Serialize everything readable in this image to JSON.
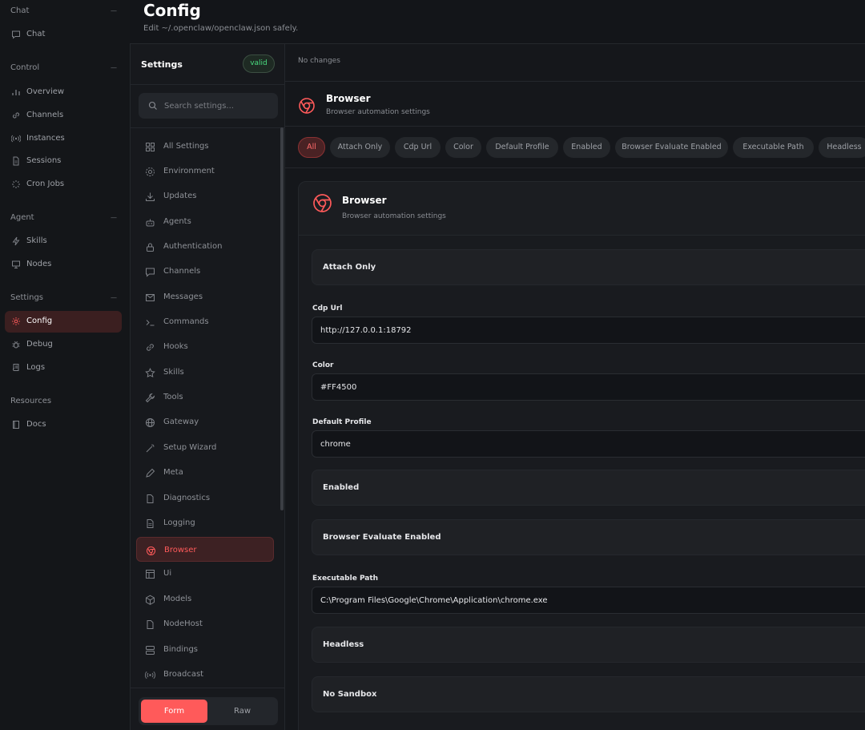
{
  "nav": {
    "groups": [
      {
        "title": "Chat",
        "items": [
          {
            "label": "Chat",
            "icon": "chat-bubble-icon"
          }
        ]
      },
      {
        "title": "Control",
        "items": [
          {
            "label": "Overview",
            "icon": "bar-chart-icon"
          },
          {
            "label": "Channels",
            "icon": "link-icon"
          },
          {
            "label": "Instances",
            "icon": "radio-icon"
          },
          {
            "label": "Sessions",
            "icon": "document-icon"
          },
          {
            "label": "Cron Jobs",
            "icon": "loader-icon"
          }
        ]
      },
      {
        "title": "Agent",
        "items": [
          {
            "label": "Skills",
            "icon": "lightning-icon"
          },
          {
            "label": "Nodes",
            "icon": "monitor-icon"
          }
        ]
      },
      {
        "title": "Settings",
        "items": [
          {
            "label": "Config",
            "icon": "gear-icon"
          },
          {
            "label": "Debug",
            "icon": "bug-icon"
          },
          {
            "label": "Logs",
            "icon": "scroll-icon"
          }
        ]
      },
      {
        "title": "Resources",
        "items": [
          {
            "label": "Docs",
            "icon": "book-icon"
          }
        ]
      }
    ],
    "active": "Config"
  },
  "header": {
    "title": "Config",
    "subtitle": "Edit ~/.openclaw/openclaw.json safely."
  },
  "settings_panel": {
    "title": "Settings",
    "status_badge": "valid",
    "search_placeholder": "Search settings...",
    "sections": [
      {
        "label": "All Settings",
        "icon": "grid-icon"
      },
      {
        "label": "Environment",
        "icon": "gear-icon"
      },
      {
        "label": "Updates",
        "icon": "download-icon"
      },
      {
        "label": "Agents",
        "icon": "robot-icon"
      },
      {
        "label": "Authentication",
        "icon": "lock-icon"
      },
      {
        "label": "Channels",
        "icon": "chat-bubble-icon"
      },
      {
        "label": "Messages",
        "icon": "mail-icon"
      },
      {
        "label": "Commands",
        "icon": "terminal-icon"
      },
      {
        "label": "Hooks",
        "icon": "link-icon"
      },
      {
        "label": "Skills",
        "icon": "star-icon"
      },
      {
        "label": "Tools",
        "icon": "wrench-icon"
      },
      {
        "label": "Gateway",
        "icon": "globe-icon"
      },
      {
        "label": "Setup Wizard",
        "icon": "wand-icon"
      },
      {
        "label": "Meta",
        "icon": "pencil-icon"
      },
      {
        "label": "Diagnostics",
        "icon": "file-icon"
      },
      {
        "label": "Logging",
        "icon": "file-text-icon"
      },
      {
        "label": "Browser",
        "icon": "chrome-icon"
      },
      {
        "label": "Ui",
        "icon": "layout-icon"
      },
      {
        "label": "Models",
        "icon": "cube-icon"
      },
      {
        "label": "NodeHost",
        "icon": "file-icon"
      },
      {
        "label": "Bindings",
        "icon": "server-icon"
      },
      {
        "label": "Broadcast",
        "icon": "broadcast-icon"
      }
    ],
    "active_section": "Browser",
    "mode_form": "Form",
    "mode_raw": "Raw"
  },
  "content": {
    "changes_status": "No changes",
    "section_title": "Browser",
    "section_subtitle": "Browser automation settings",
    "filter_chips": [
      "All",
      "Attach Only",
      "Cdp Url",
      "Color",
      "Default Profile",
      "Enabled",
      "Browser Evaluate Enabled",
      "Executable Path",
      "Headless"
    ],
    "active_chip": "All",
    "card": {
      "title": "Browser",
      "subtitle": "Browser automation settings",
      "fields": {
        "attach_only": "Attach Only",
        "cdp_url_label": "Cdp Url",
        "cdp_url_value": "http://127.0.0.1:18792",
        "color_label": "Color",
        "color_value": "#FF4500",
        "default_profile_label": "Default Profile",
        "default_profile_value": "chrome",
        "enabled": "Enabled",
        "browser_evaluate_enabled": "Browser Evaluate Enabled",
        "executable_path_label": "Executable Path",
        "executable_path_value": "C:\\Program Files\\Google\\Chrome\\Application\\chrome.exe",
        "headless": "Headless",
        "no_sandbox": "No Sandbox"
      }
    }
  },
  "colors": {
    "accent": "#ff5a5a",
    "valid_green": "#4ade80",
    "background": "#131519"
  }
}
